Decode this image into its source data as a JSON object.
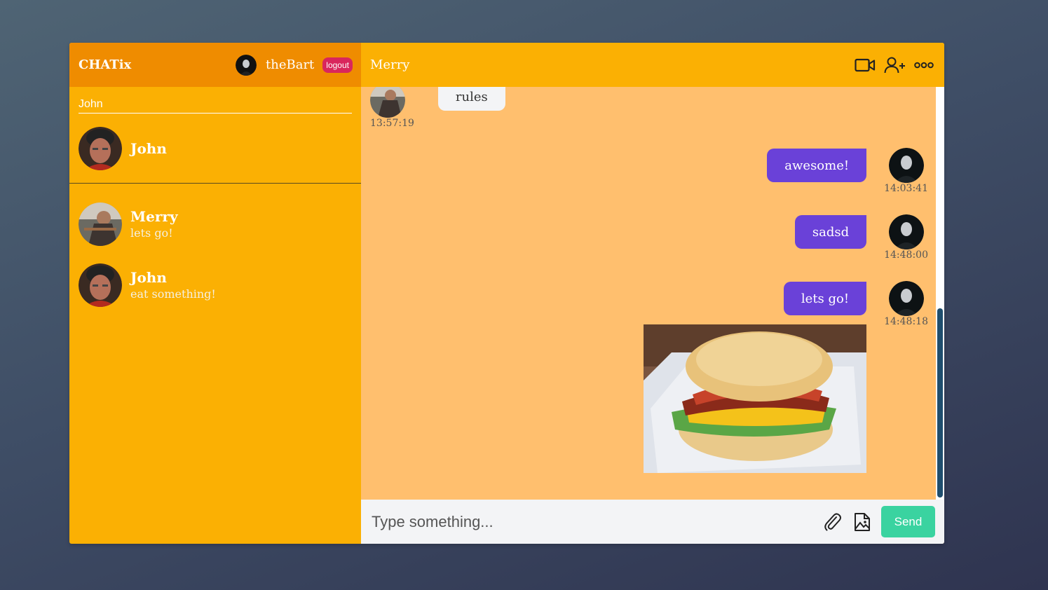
{
  "sidebar": {
    "logo": "CHATix",
    "user_name": "theBart",
    "logout_label": "logout",
    "search_value": "John",
    "found_user": {
      "name": "John"
    },
    "chats": [
      {
        "name": "Merry",
        "last_message": "lets go!"
      },
      {
        "name": "John",
        "last_message": "eat something!"
      }
    ]
  },
  "chat": {
    "title": "Merry",
    "icons": [
      "video-camera-icon",
      "add-user-icon",
      "more-options-icon"
    ],
    "messages": [
      {
        "from": "Merry",
        "text": "rules",
        "time": "13:57:19",
        "owner": false
      },
      {
        "from": "theBart",
        "text": "awesome!",
        "time": "14:03:41",
        "owner": true
      },
      {
        "from": "theBart",
        "text": "sadsd",
        "time": "14:48:00",
        "owner": true
      },
      {
        "from": "theBart",
        "text": "lets go!",
        "time": "14:48:18",
        "owner": true,
        "image": "breakfast-sandwich-photo"
      }
    ],
    "input_placeholder": "Type something...",
    "send_label": "Send"
  },
  "colors": {
    "sidebar": "#fbb003",
    "sidebar_header": "#ef8c00",
    "chat_background": "#ffbf6e",
    "outgoing_bubble": "#6a41d8",
    "send_button": "#3ad3a0",
    "logout_button": "#d9265c"
  }
}
